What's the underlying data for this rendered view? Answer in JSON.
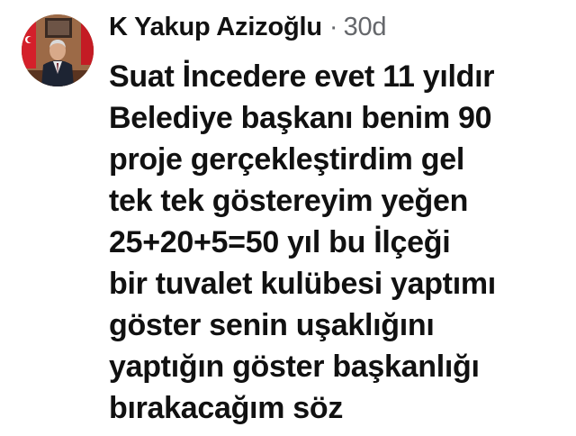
{
  "comment": {
    "avatar_icon": "profile-photo",
    "author": "K Yakup Azizoğlu",
    "separator": "·",
    "timestamp": "30d",
    "text": "Suat İncedere evet 11 yıldır\nBelediye başkanı benim 90\nproje gerçekleştirdim gel\ntek tek göstereyim yeğen\n25+20+5=50 yıl bu İlçeği\nbir tuvalet kulübesi yaptımı\ngöster senin uşaklığını\nyaptığın göster başkanlığı\nbırakacağım söz"
  },
  "colors": {
    "text_primary": "#111111",
    "text_secondary": "#65676b",
    "background": "#ffffff"
  }
}
